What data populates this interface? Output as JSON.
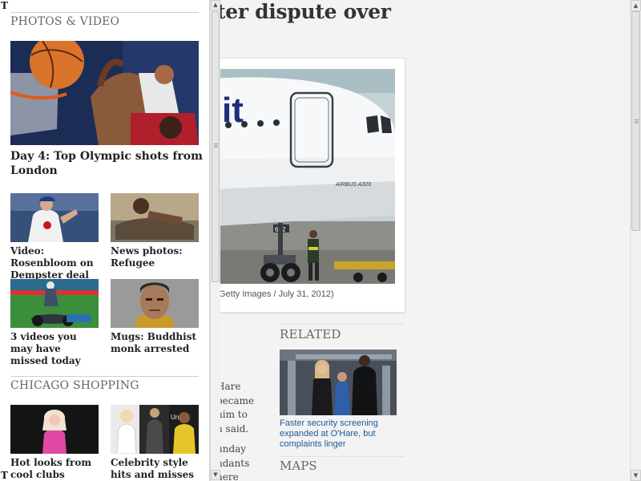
{
  "article": {
    "headline": "ter dispute over",
    "photo_credit": "Getty Images / July 31, 2012)",
    "photo_livery": "it",
    "photo_model": "AIRBUS A320",
    "photo_tail": "602",
    "text_lines_1": [
      "Hare",
      "became",
      "him to",
      "n said."
    ],
    "text_lines_2": [
      "unday",
      "ndants",
      "here"
    ]
  },
  "related": {
    "title": "RELATED",
    "link": "Faster security screening expanded at O'Hare, but complaints linger",
    "maps_title": "MAPS"
  },
  "panel": {
    "logo": "T",
    "photos_title": "PHOTOS & VIDEO",
    "hero_caption": "Day 4: Top Olympic shots from London",
    "thumbs": [
      {
        "caption": "Video: Rosenbloom on Dempster deal"
      },
      {
        "caption": "News photos: Refugee"
      },
      {
        "caption": "3 videos you may have missed today"
      },
      {
        "caption": "Mugs: Buddhist monk arrested"
      }
    ],
    "shopping_title": "CHICAGO SHOPPING",
    "shopping": [
      {
        "caption": "Hot looks from cool clubs"
      },
      {
        "caption": "Celebrity style hits and misses"
      }
    ],
    "shopping_img_text": "Uni"
  },
  "icons": {
    "scroll_up": "▲",
    "scroll_down": "▼"
  }
}
